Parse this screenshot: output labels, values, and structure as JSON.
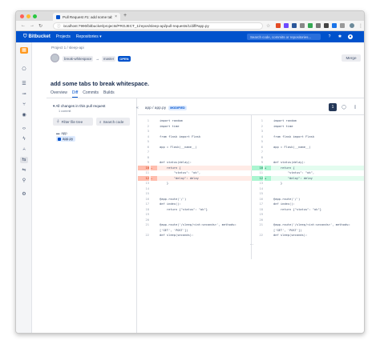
{
  "browser": {
    "tab_title": "Pull Request #1: add some tab",
    "new_tab": "+",
    "url": "localhost:7990/bitbucket/projects/PROJECT_1/repos/sleep-api/pull-requests/1/diff#app.py"
  },
  "header": {
    "brand": "Bitbucket",
    "nav": [
      "Projects",
      "Repositories ▾"
    ],
    "search_placeholder": "Search code, commits or repositories..."
  },
  "breadcrumb": {
    "project": "Project 1",
    "separator": "/",
    "repo": "sleep-api"
  },
  "pr": {
    "source_branch": "break-whitespace",
    "arrow": "→",
    "target_branch": "master",
    "status": "OPEN",
    "merge_label": "Merge",
    "title": "add some tabs to break whitespace.",
    "tabs": [
      "Overview",
      "Diff",
      "Commits",
      "Builds"
    ],
    "active_tab": "Diff"
  },
  "file_panel": {
    "changes_title": "All changes in this pull request",
    "changes_sub": "1 commit",
    "filter_label": "Filter file tree",
    "search_label": "Search code",
    "folder": "app",
    "file": "app.py"
  },
  "diff": {
    "path": "app / app.py",
    "status": "MODIFIED",
    "expand": "⋯",
    "left": [
      {
        "ln": "1",
        "mk": "",
        "code": "import random",
        "type": ""
      },
      {
        "ln": "2",
        "mk": "",
        "code": "import time",
        "type": ""
      },
      {
        "ln": "3",
        "mk": "",
        "code": "",
        "type": ""
      },
      {
        "ln": "4",
        "mk": "",
        "code": "from flask import Flask",
        "type": ""
      },
      {
        "ln": "5",
        "mk": "",
        "code": "",
        "type": ""
      },
      {
        "ln": "6",
        "mk": "",
        "code": "app = Flask(__name__)",
        "type": ""
      },
      {
        "ln": "7",
        "mk": "",
        "code": "",
        "type": ""
      },
      {
        "ln": "8",
        "mk": "",
        "code": "",
        "type": ""
      },
      {
        "ln": "9",
        "mk": "",
        "code": "def status(delay):",
        "type": ""
      },
      {
        "ln": "10",
        "mk": "—",
        "code": "    return {",
        "type": "del"
      },
      {
        "ln": "11",
        "mk": "",
        "code": "        \"status\": \"ok\",",
        "type": ""
      },
      {
        "ln": "12",
        "mk": "—",
        "code": "        \"delay\": delay",
        "type": "del"
      },
      {
        "ln": "13",
        "mk": "",
        "code": "    }",
        "type": ""
      },
      {
        "ln": "14",
        "mk": "",
        "code": "",
        "type": ""
      },
      {
        "ln": "15",
        "mk": "",
        "code": "",
        "type": ""
      },
      {
        "ln": "16",
        "mk": "",
        "code": "@app.route('/')",
        "type": ""
      },
      {
        "ln": "17",
        "mk": "",
        "code": "def index():",
        "type": ""
      },
      {
        "ln": "18",
        "mk": "",
        "code": "    return {\"status\": \"ok\"}",
        "type": ""
      },
      {
        "ln": "19",
        "mk": "",
        "code": "",
        "type": ""
      },
      {
        "ln": "20",
        "mk": "",
        "code": "",
        "type": ""
      },
      {
        "ln": "21",
        "mk": "",
        "code": "@app.route('/sleep/<int:seconds>', methods=",
        "type": ""
      },
      {
        "ln": "",
        "mk": "",
        "code": "['GET', 'POST'])",
        "type": ""
      },
      {
        "ln": "22",
        "mk": "",
        "code": "def sleep(seconds):",
        "type": ""
      }
    ],
    "right": [
      {
        "ln": "1",
        "mk": "",
        "code": "import random",
        "type": ""
      },
      {
        "ln": "2",
        "mk": "",
        "code": "import time",
        "type": ""
      },
      {
        "ln": "3",
        "mk": "",
        "code": "",
        "type": ""
      },
      {
        "ln": "4",
        "mk": "",
        "code": "from flask import Flask",
        "type": ""
      },
      {
        "ln": "5",
        "mk": "",
        "code": "",
        "type": ""
      },
      {
        "ln": "6",
        "mk": "",
        "code": "app = Flask(__name__)",
        "type": ""
      },
      {
        "ln": "7",
        "mk": "",
        "code": "",
        "type": ""
      },
      {
        "ln": "8",
        "mk": "",
        "code": "",
        "type": ""
      },
      {
        "ln": "9",
        "mk": "",
        "code": "def status(delay):",
        "type": ""
      },
      {
        "ln": "10",
        "mk": "+",
        "code": "    return {",
        "type": "add"
      },
      {
        "ln": "11",
        "mk": "",
        "code": "        \"status\": \"ok\",",
        "type": ""
      },
      {
        "ln": "12",
        "mk": "+",
        "code": "        \"delay\": delay",
        "type": "add"
      },
      {
        "ln": "13",
        "mk": "",
        "code": "    }",
        "type": ""
      },
      {
        "ln": "14",
        "mk": "",
        "code": "",
        "type": ""
      },
      {
        "ln": "15",
        "mk": "",
        "code": "",
        "type": ""
      },
      {
        "ln": "16",
        "mk": "",
        "code": "@app.route('/')",
        "type": ""
      },
      {
        "ln": "17",
        "mk": "",
        "code": "def index():",
        "type": ""
      },
      {
        "ln": "18",
        "mk": "",
        "code": "    return {\"status\": \"ok\"}",
        "type": ""
      },
      {
        "ln": "19",
        "mk": "",
        "code": "",
        "type": ""
      },
      {
        "ln": "20",
        "mk": "",
        "code": "",
        "type": ""
      },
      {
        "ln": "21",
        "mk": "",
        "code": "@app.route('/sleep/<int:seconds>', methods=",
        "type": ""
      },
      {
        "ln": "",
        "mk": "",
        "code": "['GET', 'POST'])",
        "type": ""
      },
      {
        "ln": "22",
        "mk": "",
        "code": "def sleep(seconds):",
        "type": ""
      }
    ]
  },
  "sidebar_collapse": "»",
  "colors": {
    "brand_blue": "#0052cc",
    "deleted_bg": "#ffebe6",
    "added_bg": "#e3fcef"
  }
}
